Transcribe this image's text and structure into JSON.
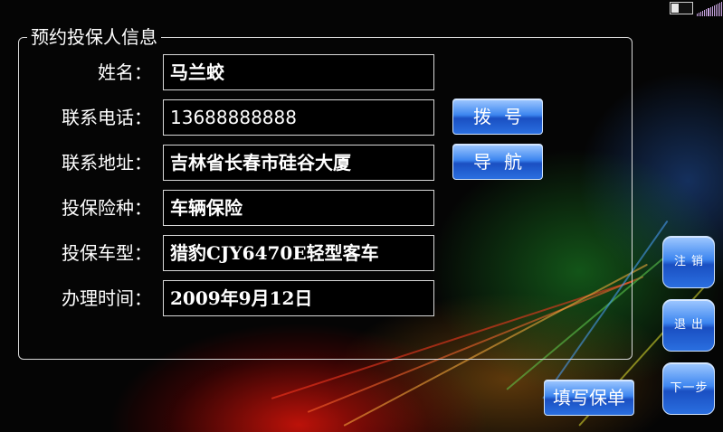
{
  "form": {
    "title": "预约投保人信息",
    "fields": [
      {
        "label": "姓名：",
        "value": "马兰蛟"
      },
      {
        "label": "联系电话：",
        "value": "13688888888"
      },
      {
        "label": "联系地址：",
        "value": "吉林省长春市硅谷大厦"
      },
      {
        "label": "投保险种：",
        "value": "车辆保险"
      },
      {
        "label": "投保车型：",
        "value": "猎豹CJY6470E轻型客车"
      },
      {
        "label": "办理时间：",
        "value": "2009年9月12日"
      }
    ]
  },
  "buttons": {
    "dial": "拨号",
    "navigate": "导航",
    "logout": "注销",
    "exit": "退出",
    "next": "下一步",
    "fill_policy": "填写保单"
  },
  "status": {
    "battery_icon": "battery-icon",
    "signal_icon": "signal-strength-icon"
  }
}
